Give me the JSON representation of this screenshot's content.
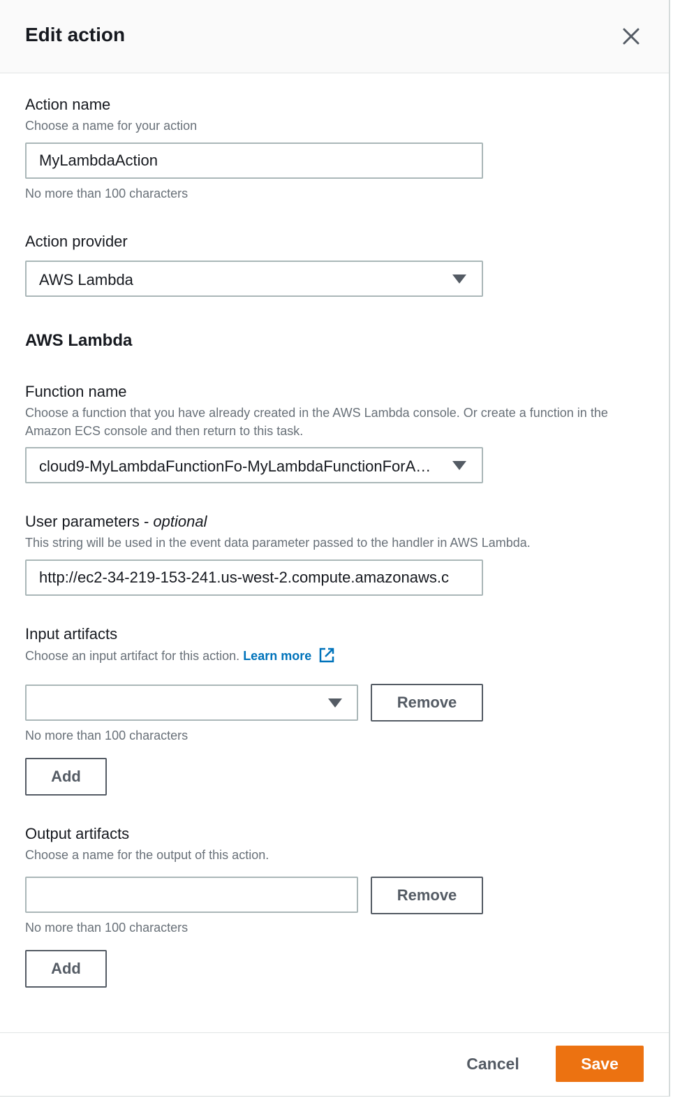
{
  "header": {
    "title": "Edit action"
  },
  "action_name": {
    "label": "Action name",
    "description": "Choose a name for your action",
    "value": "MyLambdaAction",
    "hint": "No more than 100 characters"
  },
  "action_provider": {
    "label": "Action provider",
    "selected": "AWS Lambda"
  },
  "section": {
    "title": "AWS Lambda"
  },
  "function_name": {
    "label": "Function name",
    "description": "Choose a function that you have already created in the AWS Lambda console. Or create a function in the Amazon ECS console and then return to this task.",
    "selected": "cloud9-MyLambdaFunctionFo-MyLambdaFunctionForA…"
  },
  "user_parameters": {
    "label": "User parameters - ",
    "optional": "optional",
    "description": "This string will be used in the event data parameter passed to the handler in AWS Lambda.",
    "value": "http://ec2-34-219-153-241.us-west-2.compute.amazonaws.c"
  },
  "input_artifacts": {
    "label": "Input artifacts",
    "description": "Choose an input artifact for this action.",
    "learn_more": "Learn more",
    "selected": "",
    "remove_label": "Remove",
    "hint": "No more than 100 characters",
    "add_label": "Add"
  },
  "output_artifacts": {
    "label": "Output artifacts",
    "description": "Choose a name for the output of this action.",
    "value": "",
    "remove_label": "Remove",
    "hint": "No more than 100 characters",
    "add_label": "Add"
  },
  "footer": {
    "cancel_label": "Cancel",
    "save_label": "Save"
  },
  "colors": {
    "primary": "#ec7211",
    "link": "#0073bb",
    "muted": "#687078",
    "border": "#aab7b8"
  }
}
